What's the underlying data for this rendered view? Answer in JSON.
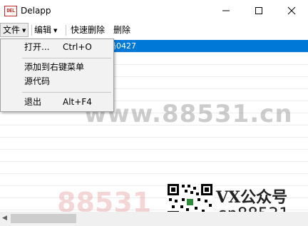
{
  "window": {
    "icon_text": "DEL",
    "title": "Delapp"
  },
  "menubar": {
    "items": [
      "文件",
      "编辑",
      "快速删除",
      "删除"
    ]
  },
  "file_menu": {
    "items": [
      {
        "label": "打开...",
        "shortcut": "Ctrl+O"
      },
      {
        "label": "添加到右键菜单",
        "shortcut": ""
      },
      {
        "label": "源代码",
        "shortcut": ""
      },
      {
        "label": "退出",
        "shortcut": "Alt+F4"
      }
    ]
  },
  "list": {
    "selected_text": "码源码0427"
  },
  "overlay": {
    "watermark": "www.88531.cn",
    "watermark_bottom": "88531",
    "badge_top": "VX公众号",
    "badge_bottom": "cn88531"
  },
  "colors": {
    "selection": "#0078d7",
    "menu_bg": "#f2f2f2"
  }
}
